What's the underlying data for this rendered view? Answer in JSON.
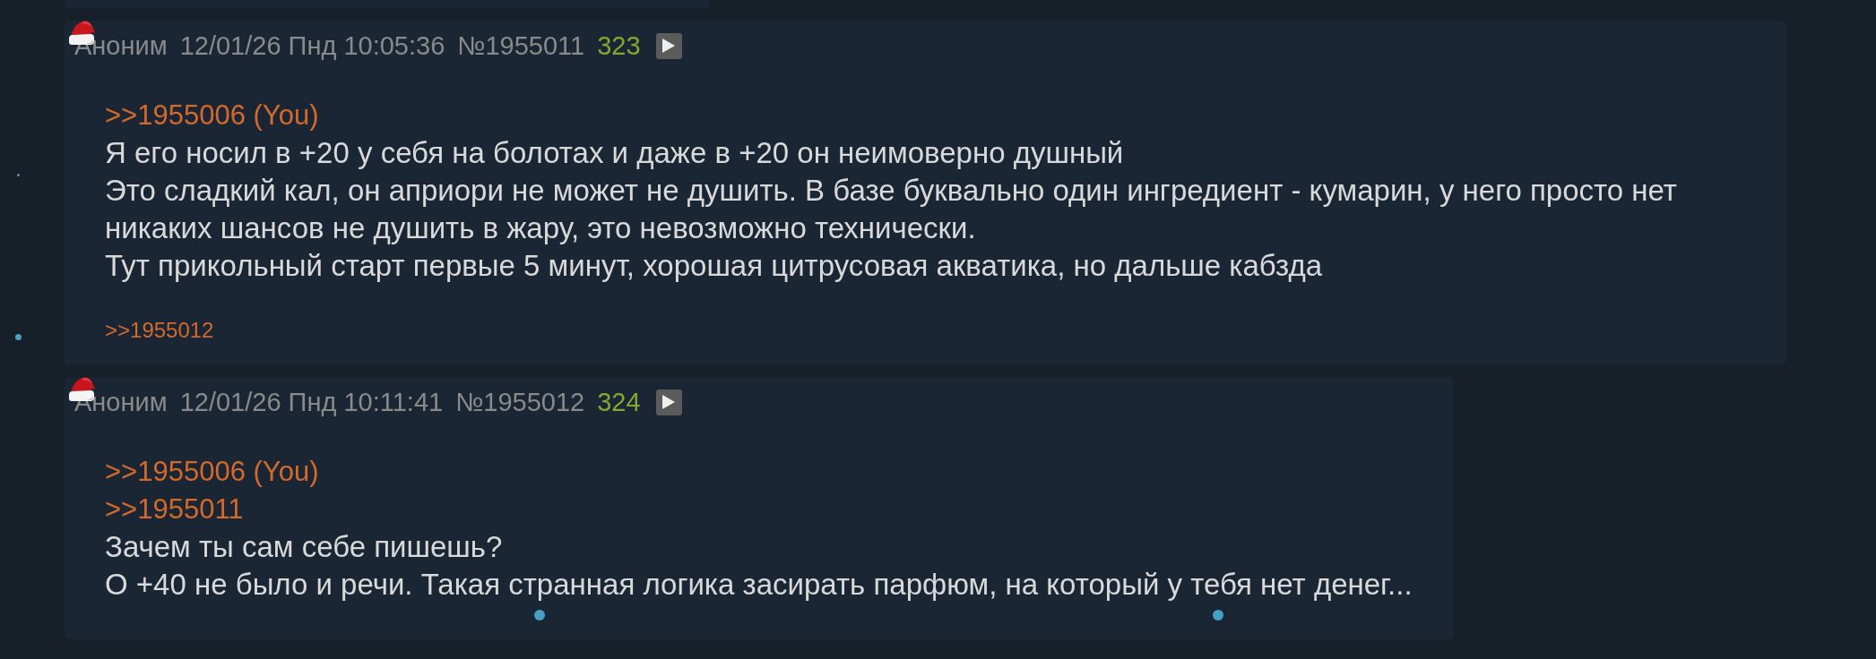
{
  "posts": [
    {
      "author": "Аноним",
      "time": "12/01/26 Пнд 10:05:36",
      "number": "№1955011",
      "count": "323",
      "message": [
        {
          "kind": "reply_link",
          "text": ">>1955006 (You)"
        },
        {
          "kind": "text",
          "lines": [
            "Я его носил в +20 у себя на болотах и даже в +20 он неимоверно душный"
          ]
        },
        {
          "kind": "text",
          "lines": [
            "Это сладкий кал, он априори не может не душить. В базе буквально один ингредиент - кумарин, у него просто нет",
            "никаких шансов не душить в жару, это невозможно технически."
          ]
        },
        {
          "kind": "text",
          "lines": [
            "Тут прикольный старт первые 5 минут, хорошая цитрусовая акватика, но дальше кабзда"
          ]
        }
      ],
      "replies": [
        ">>1955012"
      ]
    },
    {
      "author": "Аноним",
      "time": "12/01/26 Пнд 10:11:41",
      "number": "№1955012",
      "count": "324",
      "message": [
        {
          "kind": "reply_link",
          "text": ">>1955006 (You)"
        },
        {
          "kind": "reply_link",
          "text": ">>1955011"
        },
        {
          "kind": "text",
          "lines": [
            "Зачем ты сам себе пишешь?"
          ]
        },
        {
          "kind": "text",
          "lines": [
            "О +40 не было и речи. Такая странная логика засирать парфюм, на который у тебя нет денег..."
          ]
        }
      ]
    }
  ]
}
